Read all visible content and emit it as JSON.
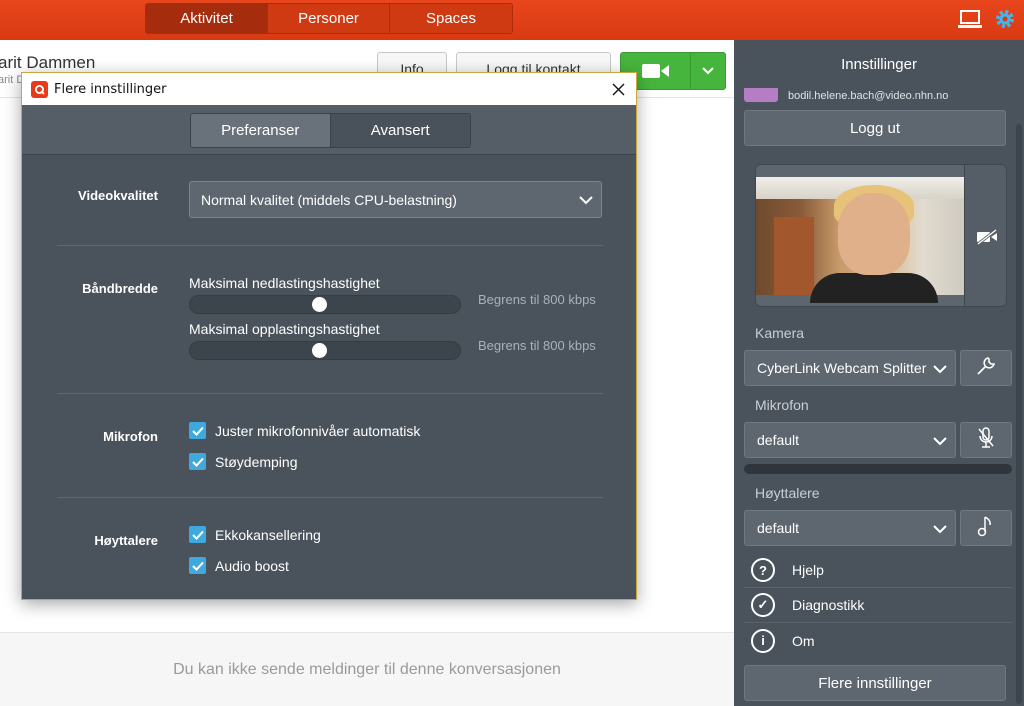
{
  "topnav": {
    "tabs": [
      {
        "label": "Aktivitet",
        "active": true
      },
      {
        "label": "Personer",
        "active": false
      },
      {
        "label": "Spaces",
        "active": false
      }
    ]
  },
  "conversation": {
    "title": "arit Dammen",
    "subtitle": "arit D",
    "info_label": "Info",
    "add_contact_label": "Logg til kontakt",
    "message_disabled": "Du kan ikke sende meldinger til denne konversasjonen"
  },
  "sidebar": {
    "title": "Innstillinger",
    "email": "bodil.helene.bach@video.nhn.no",
    "logout_label": "Logg ut",
    "camera_label": "Kamera",
    "camera_value": "CyberLink Webcam Splitter",
    "mic_label": "Mikrofon",
    "mic_value": "default",
    "speaker_label": "Høyttalere",
    "speaker_value": "default",
    "links": [
      {
        "label": "Hjelp",
        "icon": "?"
      },
      {
        "label": "Diagnostikk",
        "icon": "✓"
      },
      {
        "label": "Om",
        "icon": "i"
      }
    ],
    "more_settings_label": "Flere innstillinger"
  },
  "dialog": {
    "title": "Flere innstillinger",
    "tabs": [
      {
        "label": "Preferanser",
        "active": false
      },
      {
        "label": "Avansert",
        "active": true
      }
    ],
    "video_quality": {
      "label": "Videokvalitet",
      "value": "Normal kvalitet (middels CPU-belastning)"
    },
    "bandwidth": {
      "label": "Båndbredde",
      "download_label": "Maksimal nedlastingshastighet",
      "download_value": "Begrens til 800 kbps",
      "download_level": 0.48,
      "upload_label": "Maksimal opplastingshastighet",
      "upload_value": "Begrens til 800 kbps",
      "upload_level": 0.48
    },
    "microphone": {
      "label": "Mikrofon",
      "auto_level_label": "Juster mikrofonnivåer automatisk",
      "auto_level_checked": true,
      "noise_label": "Støydemping",
      "noise_checked": true
    },
    "speakers": {
      "label": "Høyttalere",
      "echo_label": "Ekkokansellering",
      "echo_checked": true,
      "boost_label": "Audio boost",
      "boost_checked": true
    }
  },
  "colors": {
    "topbar": "#e8461c",
    "dialog_bg": "#4a535c",
    "checkbox": "#3fa9dc",
    "video_button": "#46b53d"
  }
}
